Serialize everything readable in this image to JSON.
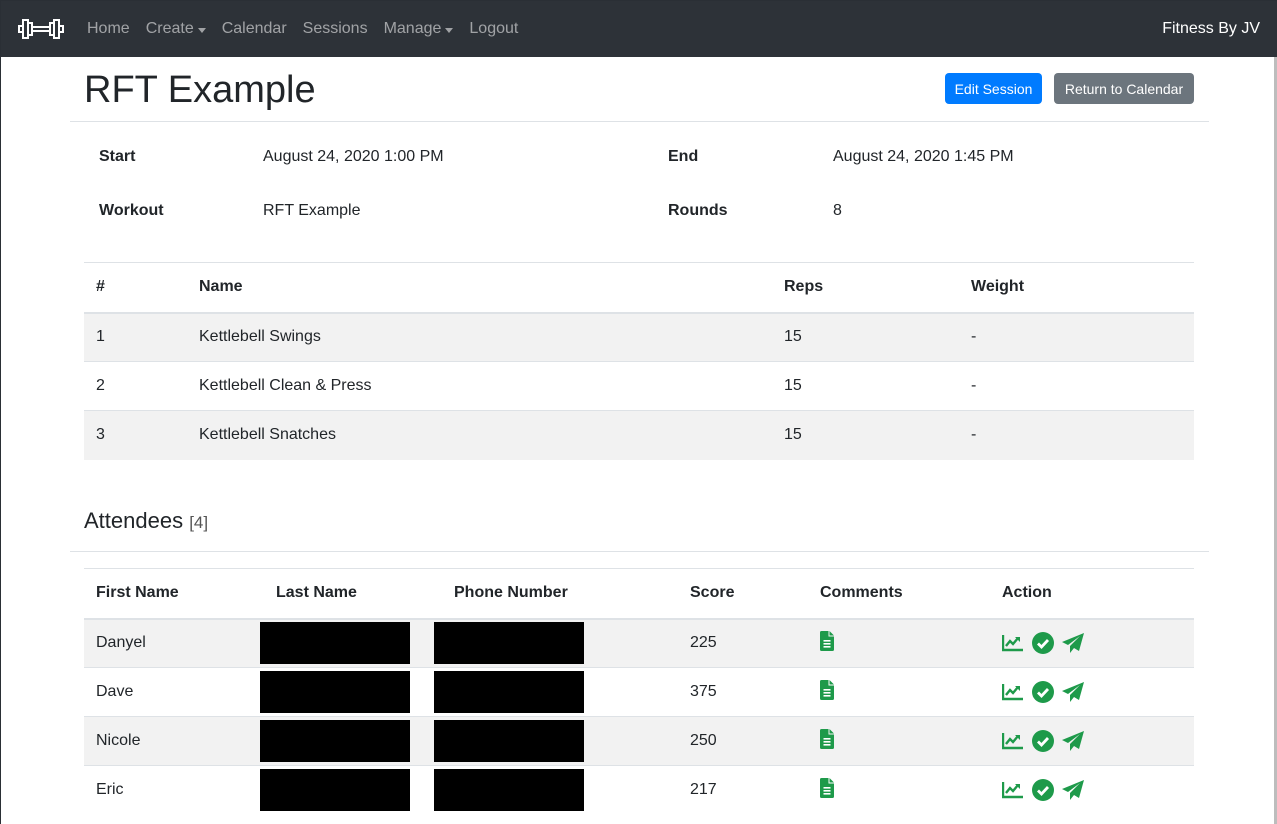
{
  "navbar": {
    "brand_icon": "dumbbell-icon",
    "links": [
      {
        "label": "Home",
        "dropdown": false
      },
      {
        "label": "Create",
        "dropdown": true
      },
      {
        "label": "Calendar",
        "dropdown": false
      },
      {
        "label": "Sessions",
        "dropdown": false
      },
      {
        "label": "Manage",
        "dropdown": true
      },
      {
        "label": "Logout",
        "dropdown": false
      }
    ],
    "right_text": "Fitness By JV"
  },
  "header": {
    "title": "RFT Example",
    "edit_button": "Edit Session",
    "return_button": "Return to Calendar"
  },
  "colors": {
    "primary": "#007bff",
    "secondary": "#6c757d",
    "navbar": "#2d3238",
    "icon_green": "#1e9a4a"
  },
  "details": {
    "start_label": "Start",
    "start_value": "August 24, 2020 1:00 PM",
    "end_label": "End",
    "end_value": "August 24, 2020 1:45 PM",
    "workout_label": "Workout",
    "workout_value": "RFT Example",
    "rounds_label": "Rounds",
    "rounds_value": "8"
  },
  "exercises": {
    "columns": [
      "#",
      "Name",
      "Reps",
      "Weight"
    ],
    "rows": [
      {
        "num": "1",
        "name": "Kettlebell Swings",
        "reps": "15",
        "weight": "-"
      },
      {
        "num": "2",
        "name": "Kettlebell Clean & Press",
        "reps": "15",
        "weight": "-"
      },
      {
        "num": "3",
        "name": "Kettlebell Snatches",
        "reps": "15",
        "weight": "-"
      }
    ]
  },
  "attendees": {
    "title": "Attendees",
    "count": "[4]",
    "columns": [
      "First Name",
      "Last Name",
      "Phone Number",
      "Score",
      "Comments",
      "Action"
    ],
    "rows": [
      {
        "first": "Danyel",
        "last": "[redacted]",
        "phone": "[redacted]",
        "score": "225"
      },
      {
        "first": "Dave",
        "last": "[redacted]",
        "phone": "[redacted]",
        "score": "375"
      },
      {
        "first": "Nicole",
        "last": "[redacted]",
        "phone": "[redacted]",
        "score": "250"
      },
      {
        "first": "Eric",
        "last": "[redacted]",
        "phone": "[redacted]",
        "score": "217"
      }
    ],
    "row_icons": {
      "comments": "file-text-icon",
      "actions": [
        "chart-line-icon",
        "check-circle-icon",
        "paper-plane-icon"
      ]
    }
  }
}
